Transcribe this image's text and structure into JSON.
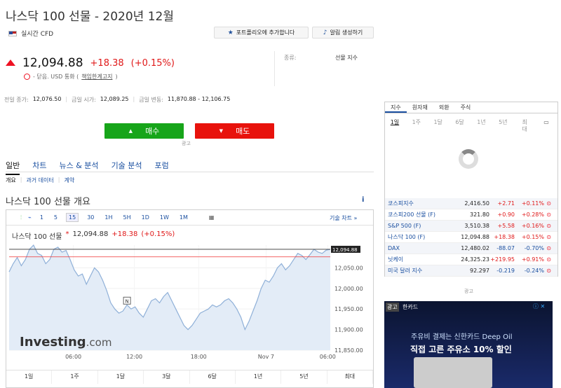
{
  "header": {
    "title": "나스닥 100 선물 - 2020년 12월",
    "realtime": "실시간 CFD",
    "portfolio_btn": "포트폴리오에 추가합니다",
    "alert_btn": "알림 생성하기"
  },
  "quote": {
    "last": "12,094.88",
    "change": "+18.38",
    "pct": "(+0.15%)",
    "status": "- 닫음. USD 통화 (",
    "disclaimer": "책임한계고지",
    "status_end": ")",
    "type_label": "종류:",
    "type_value": "선물 지수"
  },
  "stats": {
    "prev_close_label": "전일 종가:",
    "prev_close": "12,076.50",
    "open_label": "금일 시가:",
    "open": "12,089.25",
    "range_label": "금일 변동:",
    "range": "11,870.88 - 12,106.75"
  },
  "trade": {
    "buy": "매수",
    "sell": "매도",
    "ad": "광고"
  },
  "tabs": [
    "일반",
    "차트",
    "뉴스 & 분석",
    "기술 분석",
    "포럼"
  ],
  "subtabs": [
    "개요",
    "과거 데이터",
    "계약"
  ],
  "section_title": "나스닥 100 선물 개요",
  "chart_toolbar": {
    "timeframes": [
      "1",
      "5",
      "15",
      "30",
      "1H",
      "5H",
      "1D",
      "1W",
      "1M"
    ],
    "active": "15",
    "tech_chart": "기술 차트 »"
  },
  "chart_legend": {
    "name": "나스닥 100 선물",
    "last": "12,094.88",
    "change": "+18.38",
    "pct": "(+0.15%)"
  },
  "range_tabs": [
    "1일",
    "1주",
    "1달",
    "3달",
    "6달",
    "1년",
    "5년",
    "최대"
  ],
  "watermark": {
    "brand": "Investing",
    "suffix": ".com"
  },
  "chart_data": {
    "type": "area",
    "x_ticks": [
      "06:00",
      "12:00",
      "18:00",
      "Nov 7",
      "06:00"
    ],
    "y_ticks": [
      "12,050.00",
      "12,000.00",
      "11,950.00",
      "11,900.00",
      "11,850.00"
    ],
    "ylim": [
      11850,
      12105
    ],
    "last_label": "12,094.88",
    "prev_close": 12076.5,
    "values": [
      12040,
      12060,
      12075,
      12055,
      12070,
      12095,
      12105,
      12085,
      12080,
      12060,
      12070,
      12095,
      12100,
      12088,
      12092,
      12070,
      12045,
      12030,
      12035,
      12010,
      12030,
      12050,
      12040,
      12020,
      11995,
      11965,
      11950,
      11940,
      11945,
      11960,
      11950,
      11955,
      11940,
      11930,
      11950,
      11970,
      11975,
      11965,
      11980,
      11990,
      11970,
      11950,
      11930,
      11910,
      11900,
      11910,
      11925,
      11940,
      11945,
      11950,
      11960,
      11955,
      11960,
      11970,
      11975,
      11965,
      11950,
      11930,
      11900,
      11920,
      11945,
      11970,
      12000,
      12020,
      12015,
      12030,
      12050,
      12060,
      12045,
      12055,
      12070,
      12085,
      12080,
      12070,
      12082,
      12095,
      12088,
      12085,
      12093,
      12094.88
    ]
  },
  "right_panel": {
    "tabs": [
      "지수",
      "원자재",
      "외환",
      "주식"
    ],
    "periods": [
      "1일",
      "1주",
      "1달",
      "6달",
      "1년",
      "5년",
      "최대"
    ],
    "rows": [
      {
        "name": "코스피지수",
        "last": "2,416.50",
        "chg": "+2.71",
        "pct": "+0.11%",
        "dir": "pos"
      },
      {
        "name": "코스피200 선물 (F)",
        "last": "321.80",
        "chg": "+0.90",
        "pct": "+0.28%",
        "dir": "pos"
      },
      {
        "name": "S&P 500 (F)",
        "last": "3,510.38",
        "chg": "+5.58",
        "pct": "+0.16%",
        "dir": "pos"
      },
      {
        "name": "나스닥 100 (F)",
        "last": "12,094.88",
        "chg": "+18.38",
        "pct": "+0.15%",
        "dir": "pos"
      },
      {
        "name": "DAX",
        "last": "12,480.02",
        "chg": "-88.07",
        "pct": "-0.70%",
        "dir": "neg"
      },
      {
        "name": "닛케이",
        "last": "24,325.23",
        "chg": "+219.95",
        "pct": "+0.91%",
        "dir": "pos"
      },
      {
        "name": "미국 달러 지수",
        "last": "92.297",
        "chg": "-0.219",
        "pct": "-0.24%",
        "dir": "neg"
      }
    ],
    "ad_label": "광고"
  },
  "ad": {
    "tag": "광고",
    "brand": "한카드",
    "line1": "주유비 결제는 신한카드 Deep Oil",
    "line2": "직접 고른 주유소 10% 할인"
  }
}
